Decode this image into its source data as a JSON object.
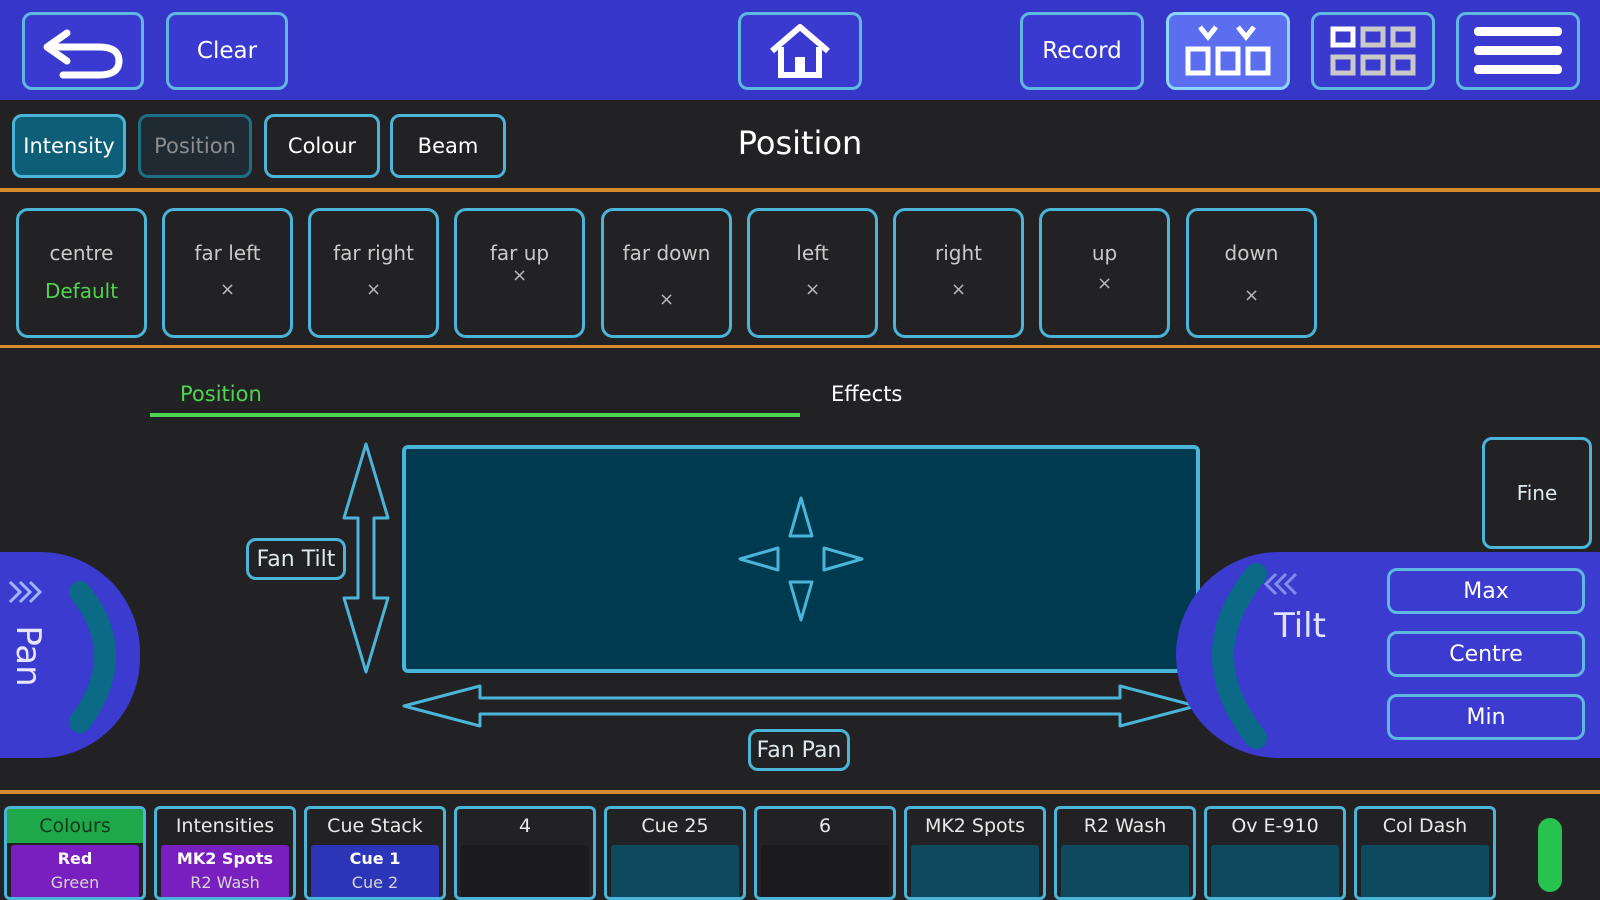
{
  "toolbar": {
    "clear_label": "Clear",
    "record_label": "Record"
  },
  "attribute_tabs": [
    {
      "label": "Intensity",
      "state": "selected"
    },
    {
      "label": "Position",
      "state": "dim"
    },
    {
      "label": "Colour",
      "state": "normal"
    },
    {
      "label": "Beam",
      "state": "normal"
    }
  ],
  "page_title": "Position",
  "palettes": [
    {
      "name": "centre",
      "value": "Default"
    },
    {
      "name": "far left",
      "value": "×"
    },
    {
      "name": "far right",
      "value": "×"
    },
    {
      "name": "far up",
      "value": "×"
    },
    {
      "name": "far down",
      "value": "×"
    },
    {
      "name": "left",
      "value": "×"
    },
    {
      "name": "right",
      "value": "×"
    },
    {
      "name": "up",
      "value": "×"
    },
    {
      "name": "down",
      "value": "×"
    }
  ],
  "subtabs": {
    "position": "Position",
    "effects": "Effects"
  },
  "pad": {
    "fan_tilt": "Fan Tilt",
    "fan_pan": "Fan Pan",
    "fine": "Fine"
  },
  "pan_panel": {
    "label": "Pan"
  },
  "tilt_panel": {
    "label": "Tilt",
    "max": "Max",
    "centre": "Centre",
    "min": "Min"
  },
  "playbacks": [
    {
      "title": "Colours",
      "line1": "Red",
      "line2": "Green",
      "style": "purple",
      "active": true
    },
    {
      "title": "Intensities",
      "line1": "MK2 Spots",
      "line2": "R2 Wash",
      "style": "purple",
      "active": false
    },
    {
      "title": "Cue Stack",
      "line1": "Cue 1",
      "line2": "Cue 2",
      "style": "blue",
      "active": false
    },
    {
      "title": "4",
      "line1": "",
      "line2": "",
      "style": "dark",
      "active": false
    },
    {
      "title": "Cue 25",
      "line1": "",
      "line2": "",
      "style": "teal",
      "active": false
    },
    {
      "title": "6",
      "line1": "",
      "line2": "",
      "style": "dark",
      "active": false
    },
    {
      "title": "MK2 Spots",
      "line1": "",
      "line2": "",
      "style": "teal",
      "active": false
    },
    {
      "title": "R2 Wash",
      "line1": "",
      "line2": "",
      "style": "teal",
      "active": false
    },
    {
      "title": "Ov E-910",
      "line1": "",
      "line2": "",
      "style": "teal",
      "active": false
    },
    {
      "title": "Col Dash",
      "line1": "",
      "line2": "",
      "style": "teal",
      "active": false
    }
  ],
  "colors": {
    "toolbar_bg": "#3636c8",
    "accent_cyan": "#4bb5d9",
    "divider_orange": "#d68a2c",
    "active_green": "#4fd44f"
  }
}
